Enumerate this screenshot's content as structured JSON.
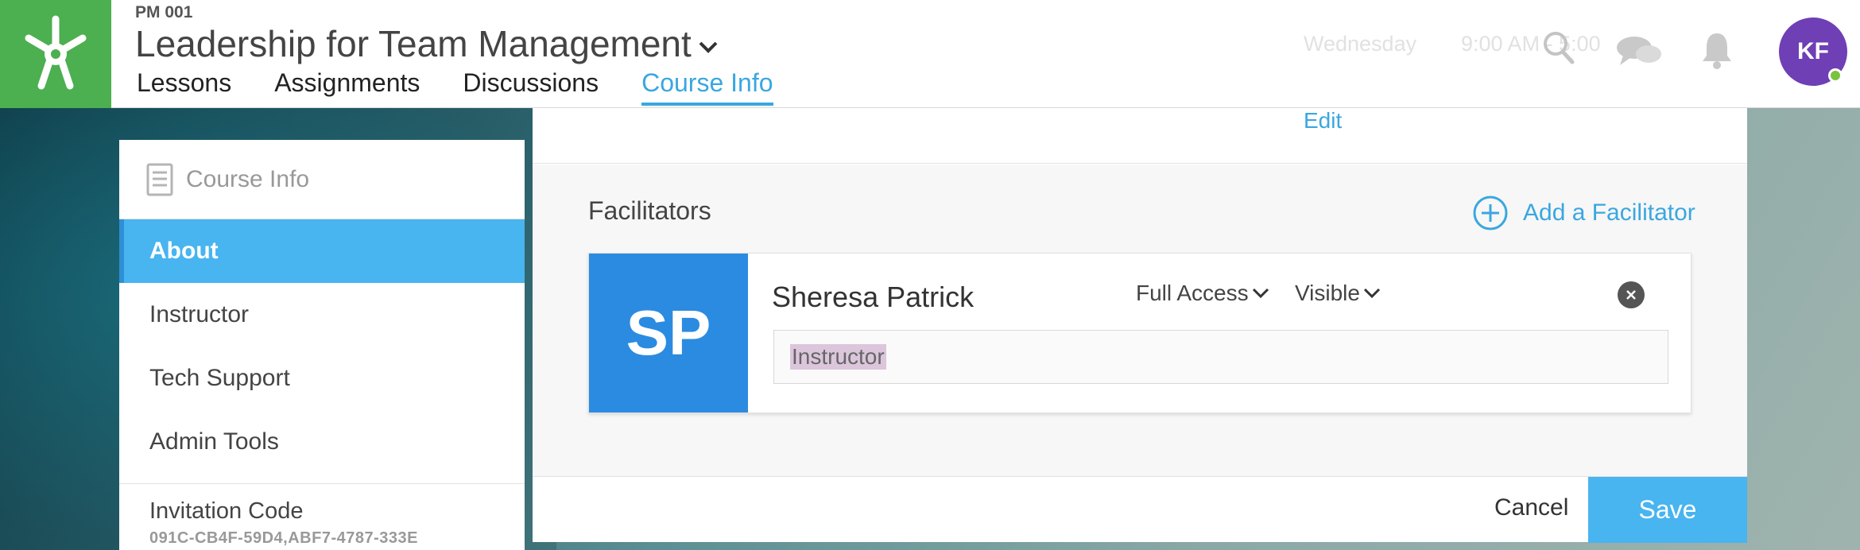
{
  "header": {
    "course_code": "PM 001",
    "course_title": "Leadership for Team Management",
    "nav": [
      "Lessons",
      "Assignments",
      "Discussions",
      "Course Info"
    ],
    "active_nav": "Course Info",
    "faded_day": "Wednesday",
    "faded_time": "9:00 AM - 5:00",
    "avatar_initials": "KF",
    "icons": [
      "search-icon",
      "chat-icon",
      "bell-icon"
    ]
  },
  "sidebar": {
    "title": "Course Info",
    "items": [
      "About",
      "Instructor",
      "Tech Support",
      "Admin Tools"
    ],
    "active": "About",
    "invitation_label": "Invitation Code",
    "invitation_code": "091C-CB4F-59D4,ABF7-4787-333E"
  },
  "main": {
    "edit_label": "Edit",
    "facilitators_title": "Facilitators",
    "add_facilitator_label": "Add a Facilitator",
    "facilitator": {
      "initials": "SP",
      "name": "Sheresa Patrick",
      "access": "Full Access",
      "visibility": "Visible",
      "role": "Instructor"
    },
    "cancel_label": "Cancel",
    "save_label": "Save"
  },
  "colors": {
    "accent": "#3aa7e0",
    "logo_green": "#4caf50",
    "avatar_purple": "#6f3fb5",
    "card_avatar_blue": "#2b8be0",
    "sidebar_active": "#48b4f0"
  }
}
